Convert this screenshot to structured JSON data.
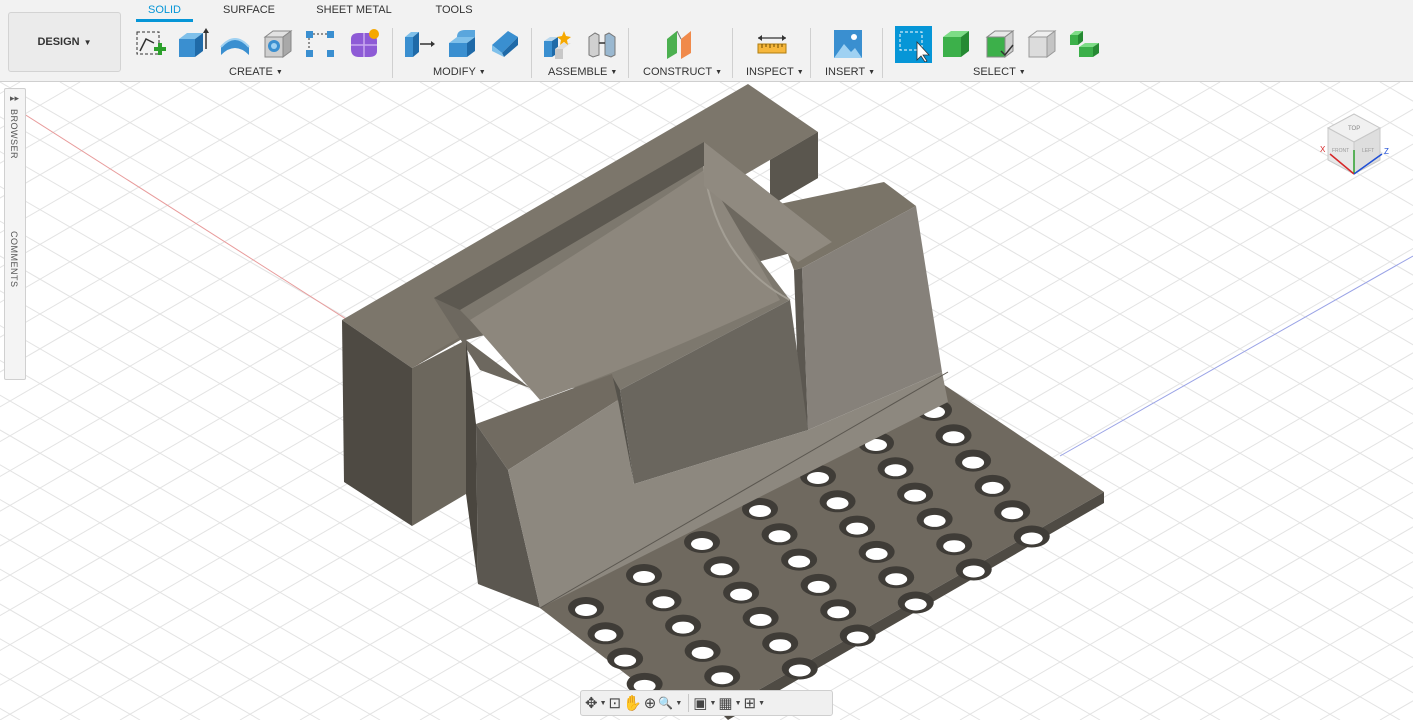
{
  "design_button": {
    "label": "DESIGN",
    "caret": "▼"
  },
  "tabs": [
    {
      "label": "SOLID",
      "active": true
    },
    {
      "label": "SURFACE",
      "active": false
    },
    {
      "label": "SHEET METAL",
      "active": false
    },
    {
      "label": "TOOLS",
      "active": false
    }
  ],
  "groups": {
    "create": "CREATE",
    "modify": "MODIFY",
    "assemble": "ASSEMBLE",
    "construct": "CONSTRUCT",
    "inspect": "INSPECT",
    "insert": "INSERT",
    "select": "SELECT"
  },
  "caret": "▼",
  "side_panel": {
    "browser": "BROWSER",
    "comments": "COMMENTS",
    "arrows": "▸▸"
  },
  "viewcube": {
    "top": "TOP",
    "front": "FRONT",
    "left": "LEFT",
    "axis_x": "X",
    "axis_z": "Z"
  },
  "nav_bar": {
    "orbit": "✥",
    "look_at": "⊡",
    "pan": "✋",
    "zoom": "⊕",
    "fit": "🔍",
    "display": "▣",
    "grid": "▦",
    "viewports": "⊞",
    "caret": "▼"
  },
  "tool_icons": [
    "create-sketch-icon",
    "extrude-icon",
    "revolve-icon",
    "hole-icon",
    "pattern-icon",
    "form-icon",
    "press-pull-icon",
    "fillet-icon",
    "chamfer-icon",
    "new-component-icon",
    "joint-icon",
    "offset-plane-icon",
    "measure-icon",
    "insert-canvas-icon",
    "select-window-icon",
    "select-body-icon",
    "select-face-icon",
    "select-edge-icon",
    "select-priority-icon"
  ],
  "colors": {
    "accent": "#0696d7",
    "model_top": "#7a7367",
    "model_side": "#5e5a52",
    "model_light": "#8d877c"
  }
}
